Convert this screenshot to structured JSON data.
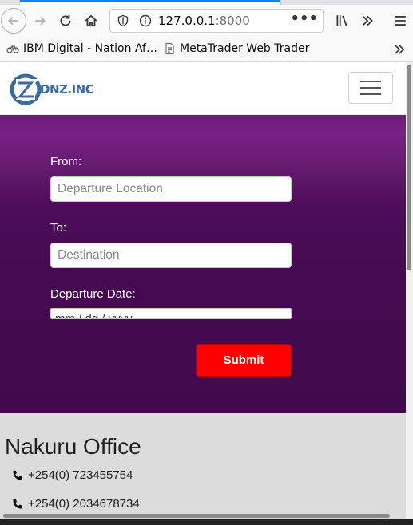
{
  "browser": {
    "url_host": "127.0.0.1",
    "url_port": ":8000",
    "bookmarks": [
      {
        "label": "IBM Digital - Nation Af…",
        "icon": "bicycle-icon"
      },
      {
        "label": "MetaTrader Web Trader",
        "icon": "page-icon"
      }
    ],
    "colors": {
      "accent": "#0a84ff"
    }
  },
  "site": {
    "logo_text": "DNZ.INC",
    "form": {
      "from_label": "From:",
      "from_placeholder": "Departure Location",
      "to_label": "To:",
      "to_placeholder": "Destination",
      "date_label": "Departure Date:",
      "date_placeholder": "mm / dd / yyyy",
      "submit_label": "Submit"
    },
    "office": {
      "title": "Nakuru Office",
      "phones": [
        "+254(0) 723455754",
        "+254(0) 2034678734"
      ]
    },
    "colors": {
      "hero": "#4e0d59",
      "submit": "#ff0000",
      "office_bg": "#dcdcdc"
    }
  }
}
